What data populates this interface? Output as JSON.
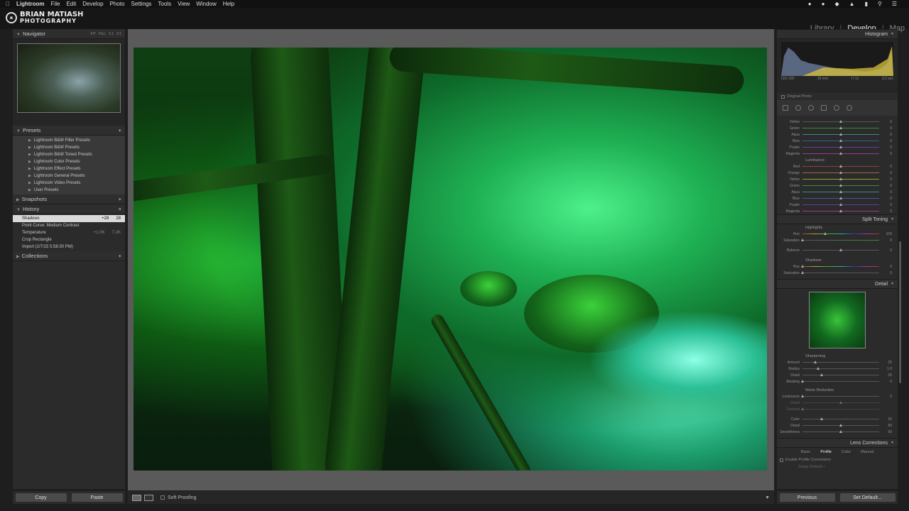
{
  "menubar": {
    "app": "Lightroom",
    "items": [
      "File",
      "Edit",
      "Develop",
      "Photo",
      "Settings",
      "Tools",
      "View",
      "Window",
      "Help"
    ]
  },
  "identity": {
    "line1": "BRIAN MATIASH",
    "line2": "PHOTOGRAPHY"
  },
  "modules": {
    "library": "Library",
    "develop": "Develop",
    "map": "Map",
    "separator": "|"
  },
  "left": {
    "navigator": {
      "title": "Navigator",
      "zoom": [
        "FIT",
        "FILL",
        "1:1",
        "3:1"
      ]
    },
    "presets": {
      "title": "Presets",
      "items": [
        "Lightroom B&W Filter Presets",
        "Lightroom B&W Presets",
        "Lightroom B&W Toned Presets",
        "Lightroom Color Presets",
        "Lightroom Effect Presets",
        "Lightroom General Presets",
        "Lightroom Video Presets",
        "User Presets"
      ]
    },
    "snapshots": {
      "title": "Snapshots"
    },
    "history": {
      "title": "History",
      "items": [
        {
          "label": "Shadows",
          "a": "+28",
          "b": "28"
        },
        {
          "label": "Point Curve: Medium Contrast",
          "a": "",
          "b": ""
        },
        {
          "label": "Temperature",
          "a": "+1.0K",
          "b": "7.2K"
        },
        {
          "label": "Crop Rectangle",
          "a": "",
          "b": ""
        },
        {
          "label": "Import (2/7/15 5:58:30 PM)",
          "a": "",
          "b": ""
        }
      ]
    },
    "collections": {
      "title": "Collections"
    },
    "copy": "Copy",
    "paste": "Paste"
  },
  "toolbar": {
    "soft_proofing": "Soft Proofing"
  },
  "right": {
    "histogram": {
      "title": "Histogram",
      "iso": "ISO 100",
      "focal": "28 mm",
      "aperture": "f / 11",
      "shutter": "3.2 sec"
    },
    "original_photo": "Original Photo",
    "saturation_rows": [
      {
        "label": "Yellow",
        "val": "0"
      },
      {
        "label": "Green",
        "val": "0"
      },
      {
        "label": "Aqua",
        "val": "0"
      },
      {
        "label": "Blue",
        "val": "0"
      },
      {
        "label": "Purple",
        "val": "0"
      },
      {
        "label": "Magenta",
        "val": "0"
      }
    ],
    "luminance": {
      "title": "Luminance",
      "rows": [
        {
          "label": "Red",
          "val": "0"
        },
        {
          "label": "Orange",
          "val": "0"
        },
        {
          "label": "Yellow",
          "val": "0"
        },
        {
          "label": "Green",
          "val": "0"
        },
        {
          "label": "Aqua",
          "val": "0"
        },
        {
          "label": "Blue",
          "val": "0"
        },
        {
          "label": "Purple",
          "val": "0"
        },
        {
          "label": "Magenta",
          "val": "0"
        }
      ]
    },
    "split_toning": {
      "title": "Split Toning",
      "highlights": "Highlights",
      "hue": {
        "label": "Hue",
        "val": "109"
      },
      "saturation": {
        "label": "Saturation",
        "val": "0"
      },
      "balance": {
        "label": "Balance",
        "val": "0"
      },
      "shadows": "Shadows",
      "sh_hue": {
        "label": "Hue",
        "val": "0"
      },
      "sh_saturation": {
        "label": "Saturation",
        "val": "0"
      }
    },
    "detail": {
      "title": "Detail",
      "sharpening": "Sharpening",
      "rows": [
        {
          "label": "Amount",
          "val": "25"
        },
        {
          "label": "Radius",
          "val": "1.0"
        },
        {
          "label": "Detail",
          "val": "25"
        },
        {
          "label": "Masking",
          "val": "0"
        }
      ],
      "noise": "Noise Reduction",
      "nr_rows": [
        {
          "label": "Luminance",
          "val": "0"
        },
        {
          "label": "Detail",
          "val": ""
        },
        {
          "label": "Contrast",
          "val": ""
        },
        {
          "label": "Color",
          "val": "25"
        },
        {
          "label": "Detail",
          "val": "50"
        },
        {
          "label": "Smoothness",
          "val": "50"
        }
      ]
    },
    "lens": {
      "title": "Lens Corrections",
      "tabs": [
        "Basic",
        "Profile",
        "Color",
        "Manual"
      ],
      "enable": "Enable Profile Corrections",
      "setup": "Setup  Default ÷"
    },
    "previous": "Previous",
    "set_default": "Set Default..."
  }
}
